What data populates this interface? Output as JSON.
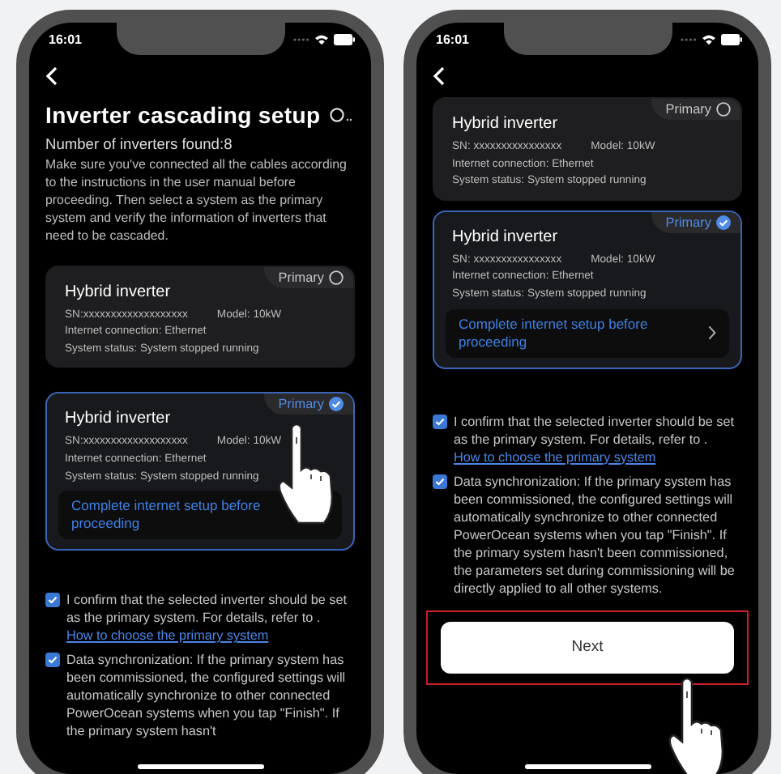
{
  "phones": [
    {
      "time": "16:01",
      "title": "Inverter cascading setup",
      "count": "Number of inverters found:8",
      "intro": "Make sure you've connected all the cables according to the instructions in the user manual before proceeding. Then select a system as the primary system and verify the information of inverters that need to be cascaded.",
      "kind": "pointer-on-primary",
      "cards": [
        {
          "name": "Hybrid inverter",
          "badge": "Primary",
          "selected": false,
          "sn": "SN:xxxxxxxxxxxxxxxxxxx",
          "model": "Model: 10kW",
          "internet": "Internet connection: Ethernet",
          "status": "System status: System stopped running"
        },
        {
          "name": "Hybrid inverter",
          "badge": "Primary",
          "selected": true,
          "sn": "SN:xxxxxxxxxxxxxxxxxxx",
          "model": "Model: 10kW",
          "internet": "Internet connection: Ethernet",
          "status": "System status: System stopped running",
          "notice": {
            "text": "Complete internet setup before proceeding",
            "chevron": false
          }
        }
      ],
      "confirmations": [
        {
          "checked": true,
          "text": "I confirm that the selected inverter should be set as the primary system. For details, refer to .",
          "link": "How to choose the primary system"
        },
        {
          "checked": true,
          "text": "Data synchronization: If the primary system has been commissioned, the configured settings will automatically synchronize to other connected PowerOcean systems when you tap \"Finish\". If the primary system hasn't"
        }
      ]
    },
    {
      "time": "16:01",
      "kind": "pointer-on-next",
      "cards": [
        {
          "name": "Hybrid inverter",
          "badge": "Primary",
          "selected": false,
          "sn": "SN: xxxxxxxxxxxxxxxx",
          "model": "Model: 10kW",
          "internet": "Internet connection: Ethernet",
          "status": "System status: System stopped running"
        },
        {
          "name": "Hybrid inverter",
          "badge": "Primary",
          "selected": true,
          "sn": "SN: xxxxxxxxxxxxxxxx",
          "model": "Model: 10kW",
          "internet": "Internet connection: Ethernet",
          "status": "System status: System stopped running",
          "notice": {
            "text": "Complete internet setup before proceeding",
            "chevron": true
          }
        }
      ],
      "confirmations": [
        {
          "checked": true,
          "text": "I confirm that the selected inverter should be set as the primary system. For details, refer to .",
          "link": "How to choose the primary system"
        },
        {
          "checked": true,
          "text": "Data synchronization: If the primary system has been commissioned, the configured settings will automatically synchronize to other connected PowerOcean systems when you tap \"Finish\". If the primary system hasn't been commissioned, the parameters set during commissioning will be directly applied to all other systems."
        }
      ],
      "next": {
        "label": "Next",
        "highlighted": true
      }
    }
  ]
}
